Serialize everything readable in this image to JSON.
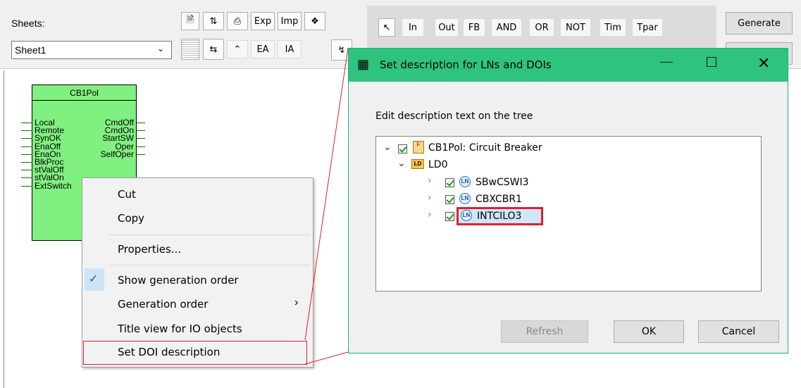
{
  "toolbar": {
    "sheets_label": "Sheets:",
    "sheet_select_value": "Sheet1",
    "btn_exp": "Exp",
    "btn_imp": "Imp",
    "btn_ea": "EA",
    "btn_ia": "IA",
    "generate": "Generate"
  },
  "palette": {
    "in": "In",
    "out": "Out",
    "fb": "FB",
    "and": "AND",
    "or": "OR",
    "not": "NOT",
    "tim": "Tim",
    "tpar": "Tpar"
  },
  "function_block": {
    "title": "CB1Pol",
    "inputs": [
      "Local",
      "Remote",
      "SynOK",
      "EnaOff",
      "EnaOn",
      "BlkProc",
      "stValOff",
      "stValOn",
      "ExtSwitch"
    ],
    "outputs": [
      "CmdOff",
      "CmdOn",
      "StartSW",
      "Oper",
      "SelfOper"
    ]
  },
  "context_menu": {
    "cut": "Cut",
    "copy": "Copy",
    "properties": "Properties...",
    "show_generation_order": "Show generation order",
    "generation_order": "Generation order",
    "title_view": "Title view for IO objects",
    "set_doi": "Set DOI description"
  },
  "dialog": {
    "title": "Set description for LNs and DOIs",
    "instruction": "Edit description text on the tree",
    "tree": {
      "root": "CB1Pol: Circuit Breaker",
      "ld": "LD0",
      "ld_badge": "LD",
      "nodes": [
        "SBwCSWI3",
        "CBXCBR1",
        "INTCILO3"
      ],
      "ln_badge": "LN"
    },
    "buttons": {
      "refresh": "Refresh",
      "ok": "OK",
      "cancel": "Cancel"
    }
  },
  "colors": {
    "block_fill": "#80f080",
    "dialog_titlebar": "#2ec47e",
    "highlight_red": "#e0202a"
  }
}
